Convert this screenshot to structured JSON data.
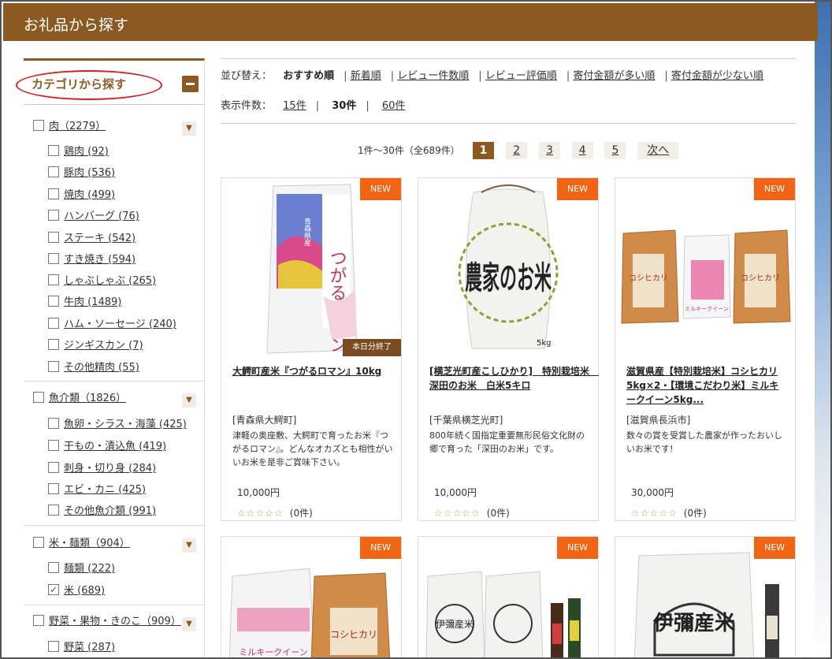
{
  "header": {
    "title": "お礼品から探す"
  },
  "sidebar": {
    "title": "カテゴリから探す",
    "groups": [
      {
        "label": "肉（2279）",
        "items": [
          "鶏肉 (92)",
          "豚肉 (536)",
          "焼肉 (499)",
          "ハンバーグ (76)",
          "ステーキ (542)",
          "すき焼き (594)",
          "しゃぶしゃぶ (265)",
          "牛肉 (1489)",
          "ハム・ソーセージ (240)",
          "ジンギスカン (7)",
          "その他精肉 (55)"
        ]
      },
      {
        "label": "魚介類（1826）",
        "items": [
          "魚卵・シラス・海藻 (425)",
          "干もの・漬込魚 (419)",
          "刺身・切り身 (284)",
          "エビ・カニ (425)",
          "その他魚介類 (991)"
        ]
      },
      {
        "label": "米・麺類（904）",
        "items": [
          "麺類 (222)",
          "米 (689)"
        ]
      },
      {
        "label": "野菜・果物・きのこ（909）",
        "items": [
          "野菜 (287)"
        ]
      }
    ]
  },
  "sort": {
    "label": "並び替え：",
    "options": [
      "おすすめ順",
      "新着順",
      "レビュー件数順",
      "レビュー評価順",
      "寄付金額が多い順",
      "寄付金額が少ない順"
    ]
  },
  "count": {
    "label": "表示件数：",
    "options": [
      "15件",
      "30件",
      "60件"
    ]
  },
  "pager": {
    "info": "1件〜30件（全689件）",
    "pages": [
      "1",
      "2",
      "3",
      "4",
      "5"
    ],
    "next": "次へ"
  },
  "products": [
    {
      "badge": "NEW",
      "soldout": "本日分終了",
      "title": "大鰐町産米『つがるロマン』10kg",
      "region": "[青森県大鰐町]",
      "desc": "津軽の奥座敷、大鰐町で育ったお米『つがるロマン』。どんなオカズとも相性がいいお米を是非ご賞味下さい。",
      "price": "10,000円",
      "stars": "☆☆☆☆☆",
      "reviews": "(0件)",
      "bag_text": "つがるロマン",
      "bag_top": "青森県産"
    },
    {
      "badge": "NEW",
      "title": "[横芝光町産こしひかり]　特別栽培米　深田のお米　白米5キロ",
      "region": "[千葉県横芝光町]",
      "desc": "800年続く国指定重要無形民俗文化財の郷で育った「深田のお米」です。",
      "price": "10,000円",
      "stars": "☆☆☆☆☆",
      "reviews": "(0件)",
      "bag_text": "農家のお米",
      "bag_weight": "5kg"
    },
    {
      "badge": "NEW",
      "title": "滋賀県産【特別栽培米】コシヒカリ5kg×2・【環境こだわり米】ミルキークイーン5kg...",
      "region": "[滋賀県長浜市]",
      "desc": "数々の賞を受賞した農家が作ったおいしいお米です!",
      "price": "30,000円",
      "stars": "☆☆☆☆☆",
      "reviews": "(0件)",
      "bag_text_a": "コシヒカリ",
      "bag_text_b": "ミルキークイーン"
    },
    {
      "badge": "NEW",
      "bag_text_a": "ミルキークイーン",
      "bag_text_b": "コシヒカリ"
    },
    {
      "badge": "NEW",
      "bag_text": "伊彌産米"
    },
    {
      "badge": "NEW",
      "bag_text": "伊彌産米"
    }
  ]
}
